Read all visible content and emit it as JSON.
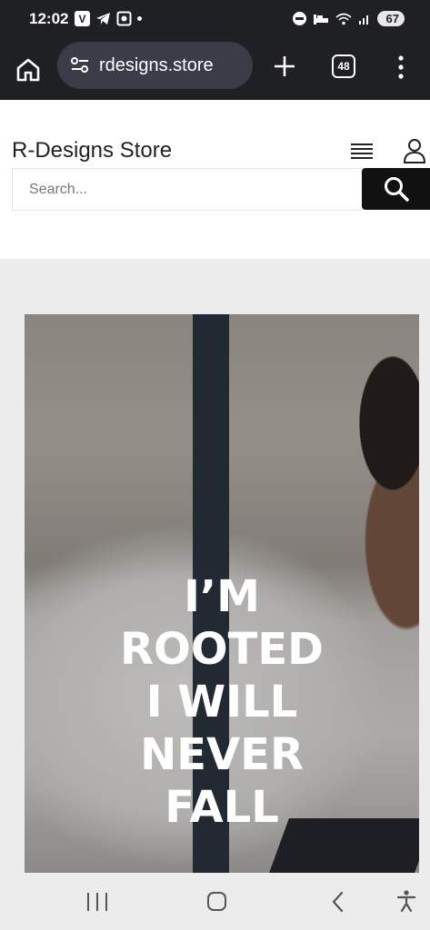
{
  "status_bar": {
    "time": "12:02",
    "battery": "67"
  },
  "browser": {
    "url": "rdesigns.store",
    "tab_count": "48",
    "icons": [
      "home-icon",
      "site-settings-icon",
      "plus-icon",
      "tabs-icon",
      "more-icon"
    ]
  },
  "store": {
    "title": "R-Designs Store",
    "search": {
      "placeholder": "Search..."
    },
    "icons": [
      "hamburger-menu-icon",
      "user-icon",
      "search-icon"
    ]
  },
  "hero": {
    "lines": [
      "I’M",
      "ROOTED",
      "I WILL",
      "NEVER",
      "FALL"
    ]
  },
  "nav": {
    "icons": [
      "recents-icon",
      "home-icon",
      "back-icon",
      "accessibility-icon"
    ]
  },
  "colors": {
    "system_bar": "#1f2024",
    "url_pill": "#3a3d47",
    "search_button": "#111111",
    "content_bg": "#ececec"
  }
}
